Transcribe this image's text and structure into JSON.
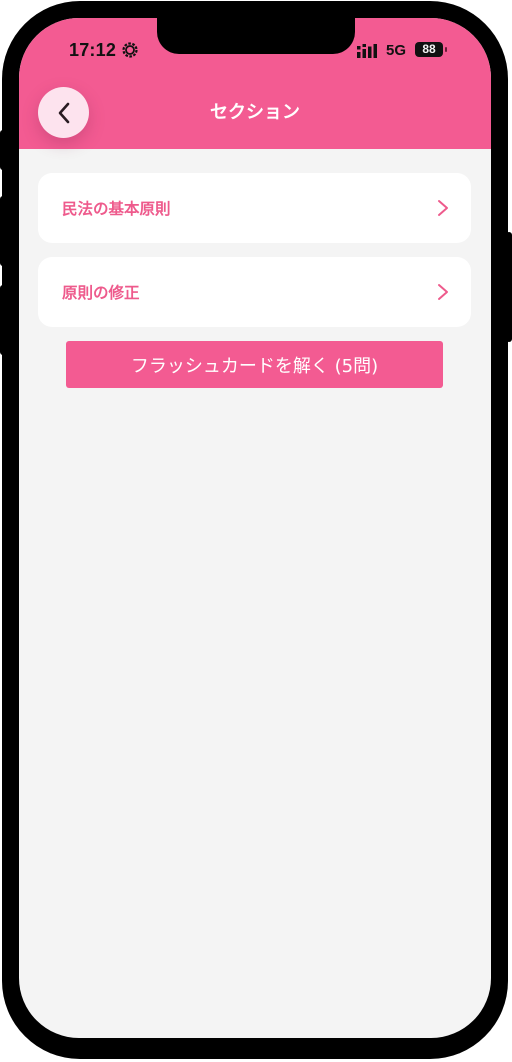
{
  "status_bar": {
    "time": "17:12",
    "network": "5G",
    "battery": "88",
    "icons": [
      "gear-icon",
      "signal-icon",
      "battery-icon"
    ]
  },
  "header": {
    "title": "セクション",
    "back_icon": "chevron-left-icon"
  },
  "sections": [
    {
      "label": "民法の基本原則"
    },
    {
      "label": "原則の修正"
    }
  ],
  "flashcard_button": {
    "label": "フラッシュカードを解く (5問)"
  },
  "colors": {
    "accent": "#f35b92",
    "section_text": "#ee5a8c",
    "background": "#f4f4f4",
    "back_button_bg": "#fde3ee"
  }
}
